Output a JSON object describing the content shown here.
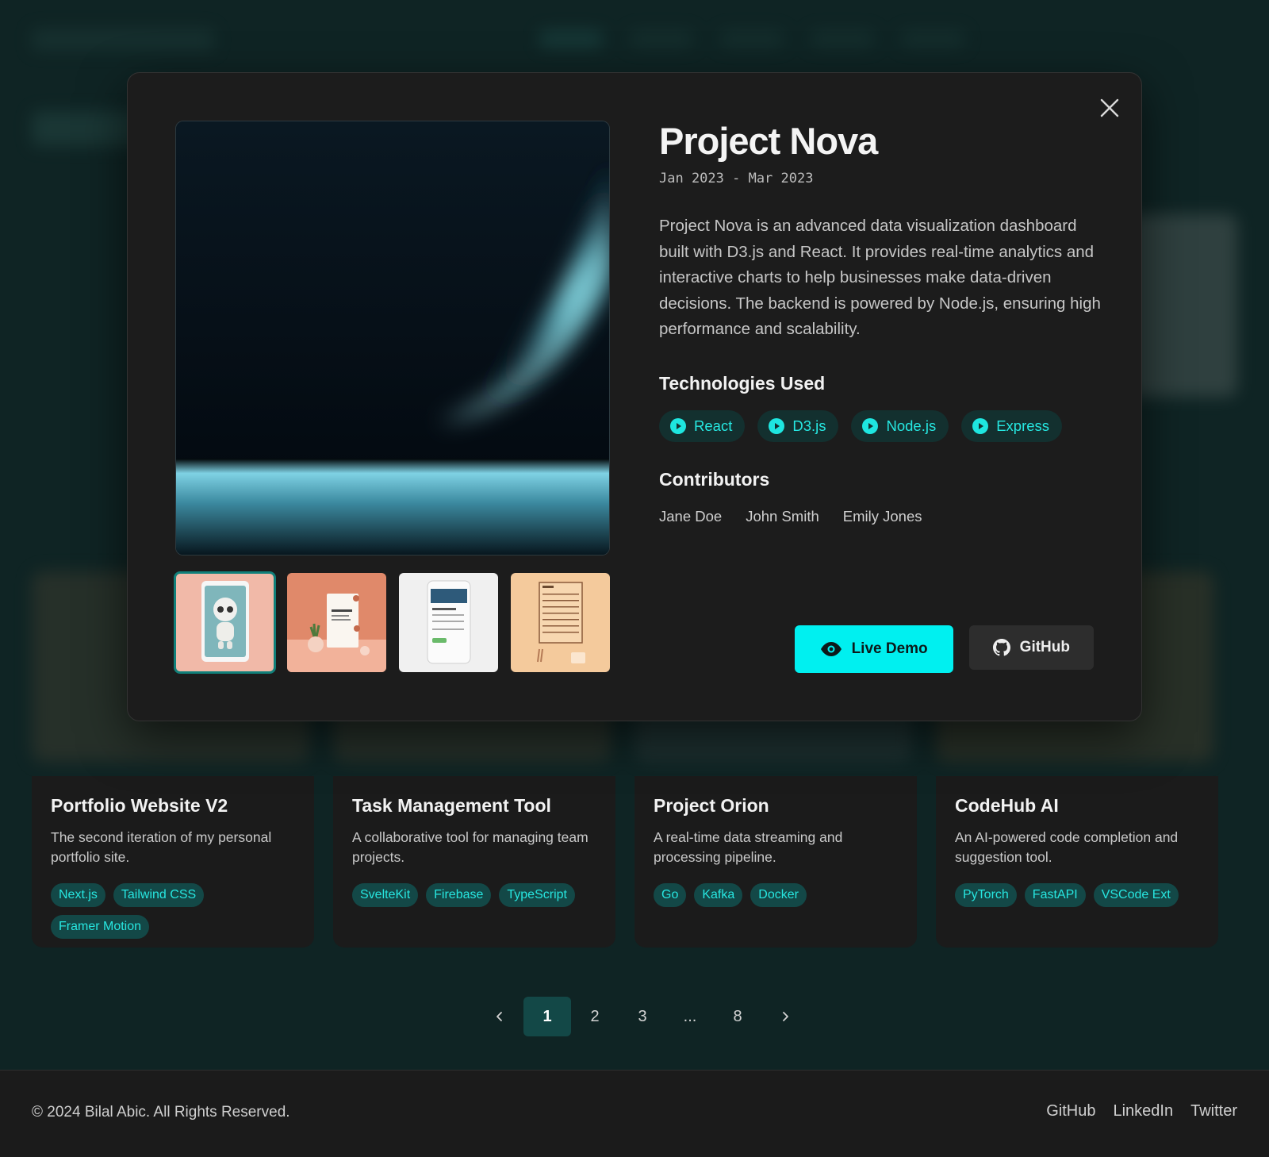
{
  "modal": {
    "title": "Project Nova",
    "date_range": "Jan 2023 - Mar 2023",
    "description": "Project Nova is an advanced data visualization dashboard built with D3.js and React. It provides real-time analytics and interactive charts to help businesses make data-driven decisions. The backend is powered by Node.js, ensuring high performance and scalability.",
    "technologies_heading": "Technologies Used",
    "technologies": [
      {
        "label": "React",
        "icon": "play-circle-icon"
      },
      {
        "label": "D3.js",
        "icon": "play-circle-icon"
      },
      {
        "label": "Node.js",
        "icon": "play-circle-icon"
      },
      {
        "label": "Express",
        "icon": "play-circle-icon"
      }
    ],
    "contributors_heading": "Contributors",
    "contributors": [
      "Jane Doe",
      "John Smith",
      "Emily Jones"
    ],
    "buttons": {
      "live_demo": {
        "label": "Live Demo",
        "icon": "eye-icon"
      },
      "github": {
        "label": "GitHub",
        "icon": "github-icon"
      }
    },
    "close_icon": "close-icon",
    "thumbnails": [
      {
        "name": "robot-tablet-thumbnail",
        "active": true
      },
      {
        "name": "mockup-card-thumbnail",
        "active": false
      },
      {
        "name": "phone-app-thumbnail",
        "active": false
      },
      {
        "name": "task-board-thumbnail",
        "active": false
      }
    ]
  },
  "projects": [
    {
      "title": "Portfolio Website V2",
      "description": "The second iteration of my personal portfolio site.",
      "tags": [
        "Next.js",
        "Tailwind CSS",
        "Framer Motion"
      ]
    },
    {
      "title": "Task Management Tool",
      "description": "A collaborative tool for managing team projects.",
      "tags": [
        "SvelteKit",
        "Firebase",
        "TypeScript"
      ]
    },
    {
      "title": "Project Orion",
      "description": "A real-time data streaming and processing pipeline.",
      "tags": [
        "Go",
        "Kafka",
        "Docker"
      ]
    },
    {
      "title": "CodeHub AI",
      "description": "An AI-powered code completion and suggestion tool.",
      "tags": [
        "PyTorch",
        "FastAPI",
        "VSCode Ext"
      ]
    }
  ],
  "pagination": {
    "pages": [
      "1",
      "2",
      "3",
      "...",
      "8"
    ],
    "current": "1"
  },
  "footer": {
    "copyright": "© 2024 Bilal Abic. All Rights Reserved.",
    "links": [
      "GitHub",
      "LinkedIn",
      "Twitter"
    ]
  },
  "colors": {
    "accent": "#00f0f0",
    "tag_bg": "#134847",
    "tag_text": "#27e6e0",
    "page_bg": "#0f2424",
    "surface": "#1c1c1c"
  }
}
